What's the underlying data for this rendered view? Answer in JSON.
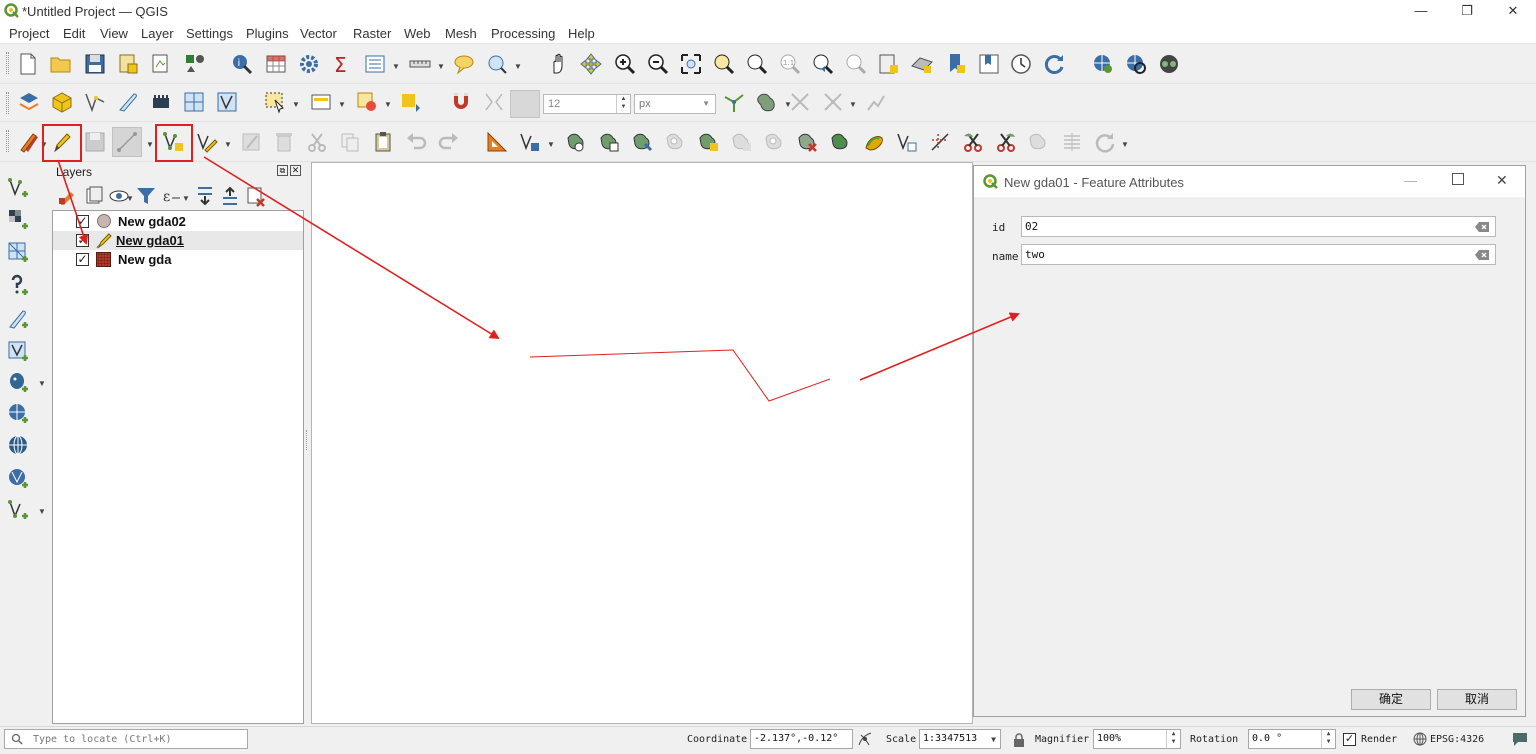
{
  "window": {
    "title": "*Untitled Project — QGIS",
    "controls": {
      "minimize": "—",
      "restore": "❐",
      "close": "✕"
    }
  },
  "menu": [
    "Project",
    "Edit",
    "View",
    "Layer",
    "Settings",
    "Plugins",
    "Vector",
    "Raster",
    "Web",
    "Mesh",
    "Processing",
    "Help"
  ],
  "snapping": {
    "tolerance": "12",
    "unit": "px"
  },
  "layers_panel": {
    "title": "Layers",
    "layers": [
      {
        "name": "New gda02",
        "checked": "✓",
        "type": "point",
        "selected": false
      },
      {
        "name": "New gda01",
        "checked": "✓",
        "type": "line",
        "selected": true
      },
      {
        "name": "New gda",
        "checked": "✓",
        "type": "polygon",
        "selected": false
      }
    ]
  },
  "dialog": {
    "title": "New gda01 - Feature Attributes",
    "fields": [
      {
        "label": "id",
        "value": "02"
      },
      {
        "label": "name",
        "value": "two"
      }
    ],
    "ok_label": "确定",
    "cancel_label": "取消"
  },
  "statusbar": {
    "locator_placeholder": "Type to locate (Ctrl+K)",
    "coordinate_label": "Coordinate",
    "coordinate_value": "-2.137°,-0.12°",
    "scale_label": "Scale",
    "scale_value": "1:3347513",
    "magnifier_label": "Magnifier",
    "magnifier_value": "100%",
    "rotation_label": "Rotation",
    "rotation_value": "0.0 °",
    "render_label": "Render",
    "render_checked": "✓",
    "crs": "EPSG:4326"
  },
  "colors": {
    "annotation_red": "#e02020",
    "qgis_green": "#589632",
    "qgis_yellow": "#f0c419"
  }
}
